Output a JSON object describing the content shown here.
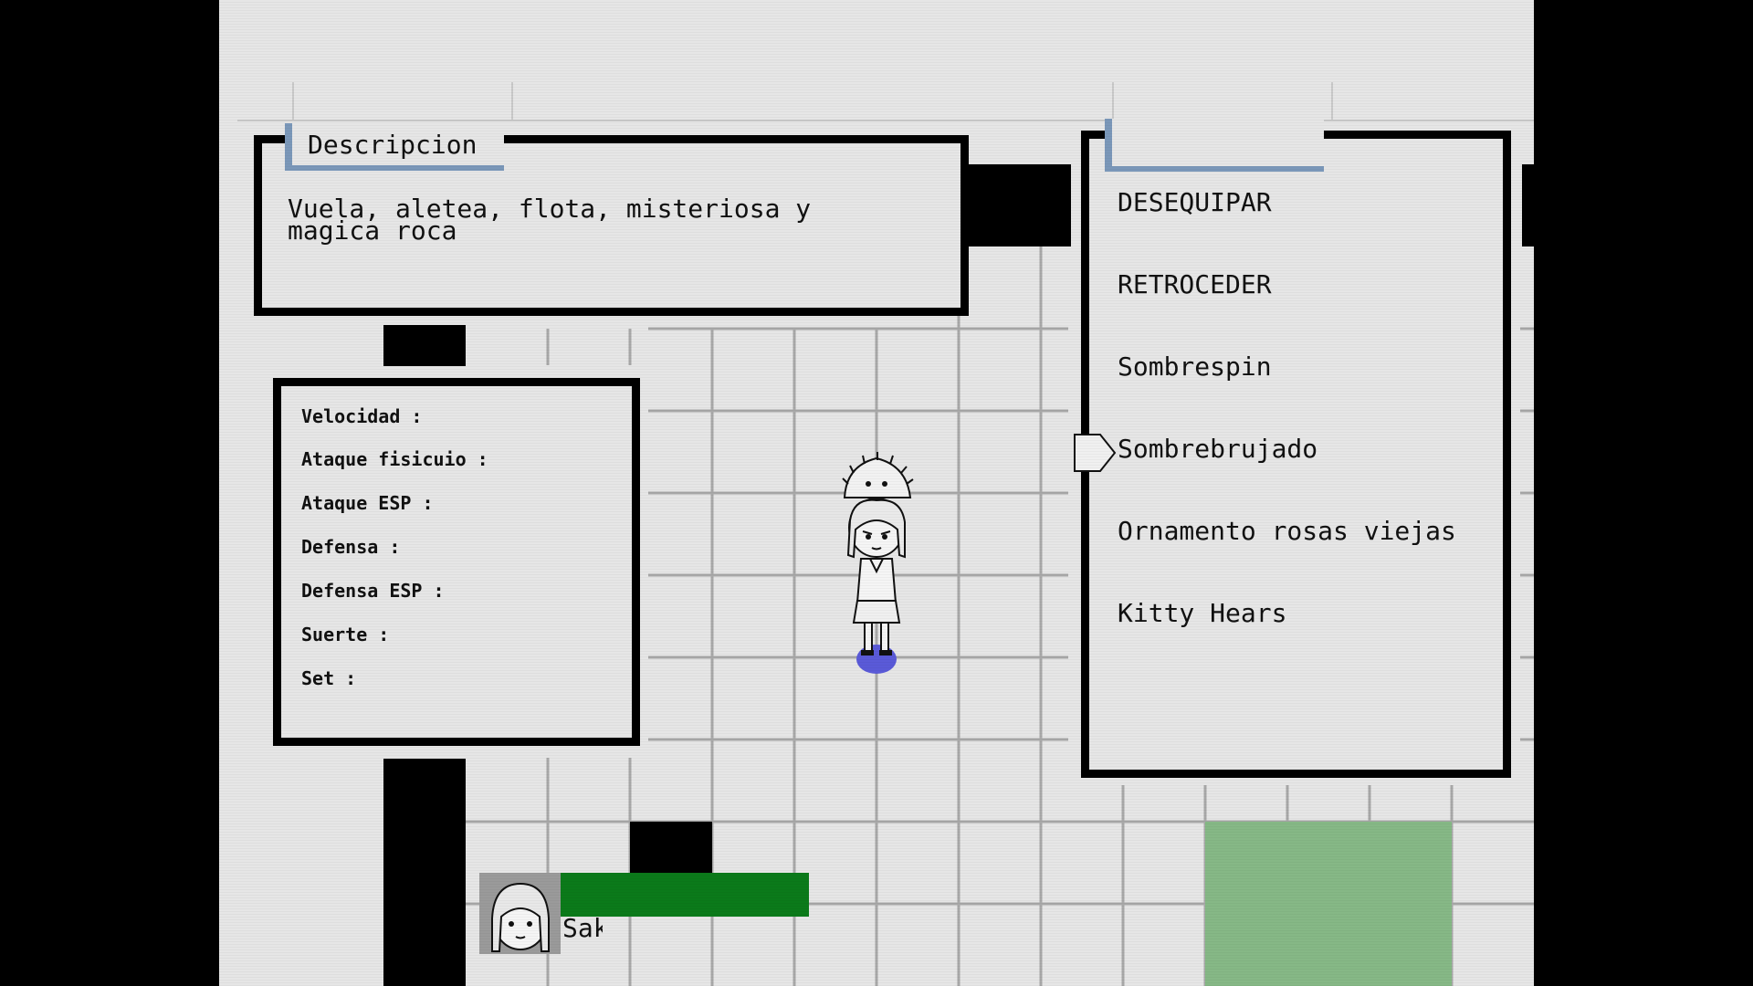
{
  "description_panel": {
    "title": "Descripcion",
    "text": "Vuela, aletea, flota, misteriosa y\nmagica roca"
  },
  "stats_panel": {
    "rows": [
      "Velocidad :",
      "Ataque fisicuio :",
      "Ataque ESP :",
      "Defensa :",
      "Defensa ESP :",
      "Suerte :",
      "Set :"
    ]
  },
  "equip_menu": {
    "items": [
      "DESEQUIPAR",
      "RETROCEDER",
      "Sombrespin",
      "Sombrebrujado",
      "Ornamento rosas viejas",
      "Kitty Hears"
    ],
    "selected": "Sombrebrujado"
  },
  "hud": {
    "name": "Sakura",
    "hp_fraction": 1.0
  },
  "colors": {
    "background": "#e6e6e6",
    "hp_bar": "#0b7a1a",
    "tab_accent": "#7a97b9",
    "goal_tiles": "#86b886",
    "player_marker": "#5a5ad8"
  }
}
